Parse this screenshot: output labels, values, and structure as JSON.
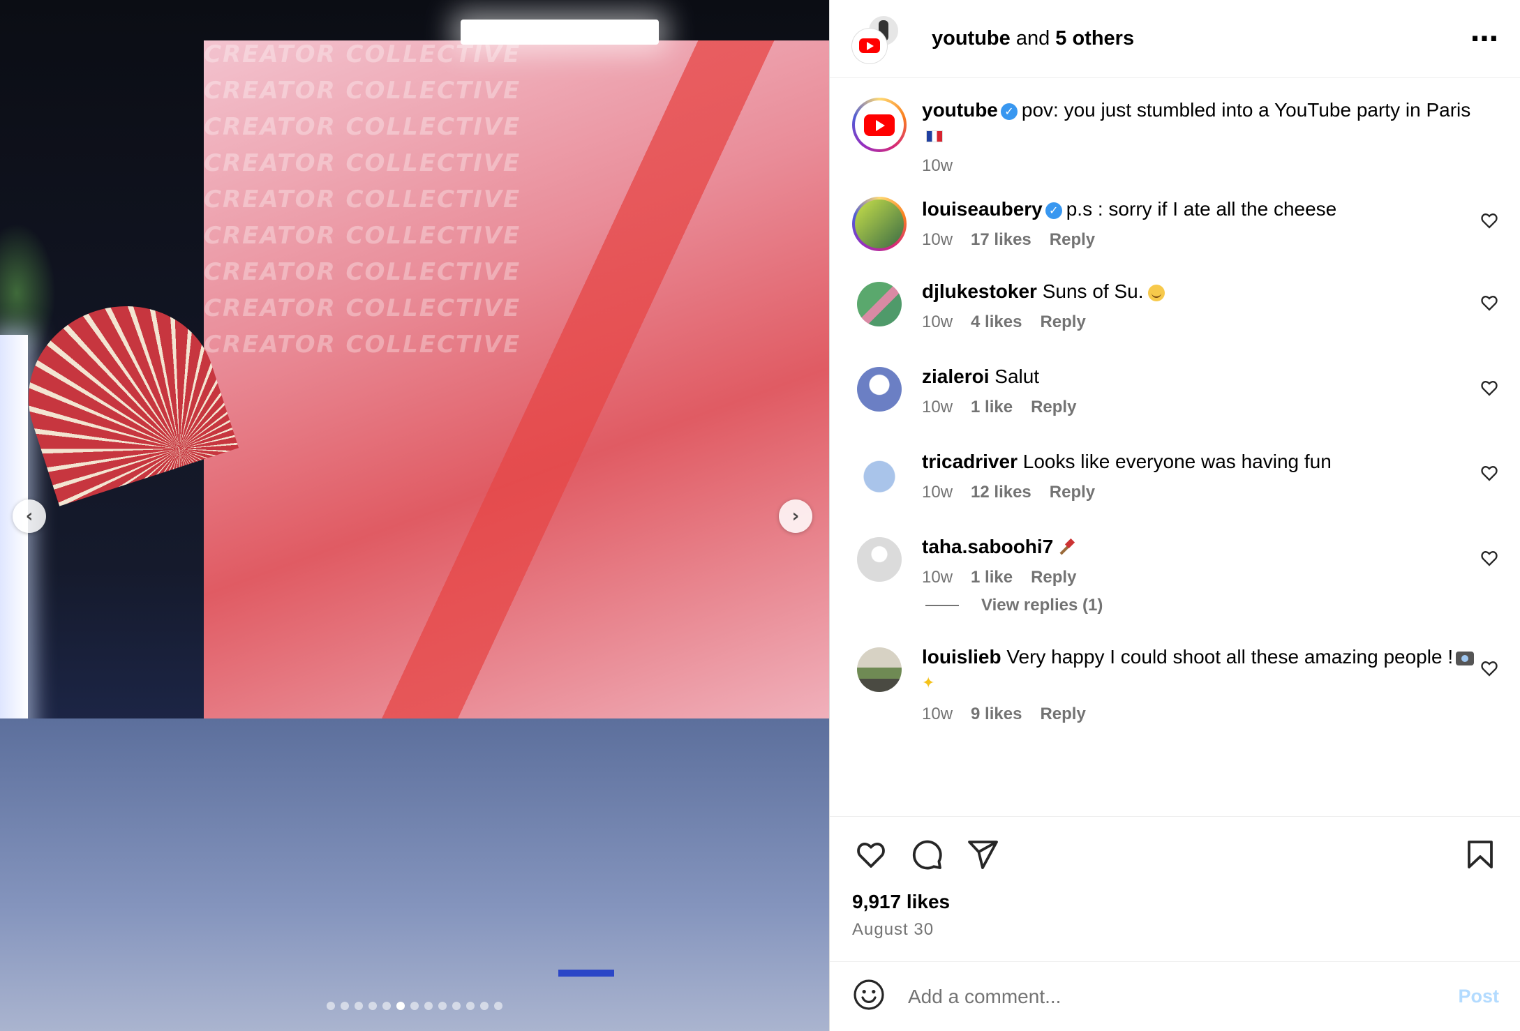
{
  "media": {
    "backdrop_text": "CREATOR COLLECTIVE",
    "slides": {
      "count": 13,
      "active_index": 5
    }
  },
  "header": {
    "account": "youtube",
    "connector": " and ",
    "others": "5 others",
    "more_icon": "more-horizontal-icon"
  },
  "caption": {
    "username": "youtube",
    "verified": true,
    "text": "pov: you just stumbled into a YouTube party in Paris",
    "flag_icon": "france-flag-icon",
    "time": "10w"
  },
  "comments": [
    {
      "username": "louiseaubery",
      "verified": true,
      "text": "p.s : sorry if I ate all the cheese",
      "time": "10w",
      "likes": "17 likes",
      "reply": "Reply",
      "avatar_color": "#3a6b45"
    },
    {
      "username": "djlukestoker",
      "verified": false,
      "text": "Suns of Su.",
      "emoji": "smiling-face-icon",
      "time": "10w",
      "likes": "4 likes",
      "reply": "Reply",
      "avatar_color": "#5aa86d"
    },
    {
      "username": "zialeroi",
      "verified": false,
      "text": "Salut",
      "time": "10w",
      "likes": "1 like",
      "reply": "Reply",
      "avatar_color": "#6b7fc4"
    },
    {
      "username": "tricadriver",
      "verified": false,
      "text": "Looks like everyone was having fun",
      "time": "10w",
      "likes": "12 likes",
      "reply": "Reply",
      "avatar_color": "#8fb3dd"
    },
    {
      "username": "taha.saboohi7",
      "verified": false,
      "text": "",
      "emoji": "razor-icon",
      "time": "10w",
      "likes": "1 like",
      "reply": "Reply",
      "avatar_color": "#dbdbdb",
      "view_replies": "View replies (1)"
    },
    {
      "username": "louislieb",
      "verified": false,
      "text": "Very happy I could shoot all these amazing people !",
      "emoji": "camera-sparkles-icon",
      "time": "10w",
      "likes": "9 likes",
      "reply": "Reply",
      "avatar_color": "#8a7a5a"
    }
  ],
  "actions": {
    "like_icon": "heart-icon",
    "comment_icon": "comment-icon",
    "share_icon": "send-icon",
    "save_icon": "bookmark-icon"
  },
  "likes": "9,917 likes",
  "date": "August 30",
  "add_comment": {
    "placeholder": "Add a comment...",
    "post_label": "Post",
    "emoji_icon": "smile-icon"
  },
  "colors": {
    "link_blue": "#3897f0",
    "post_disabled": "#b3dbff",
    "secondary_text": "#737373",
    "youtube_red": "#ff0000"
  }
}
